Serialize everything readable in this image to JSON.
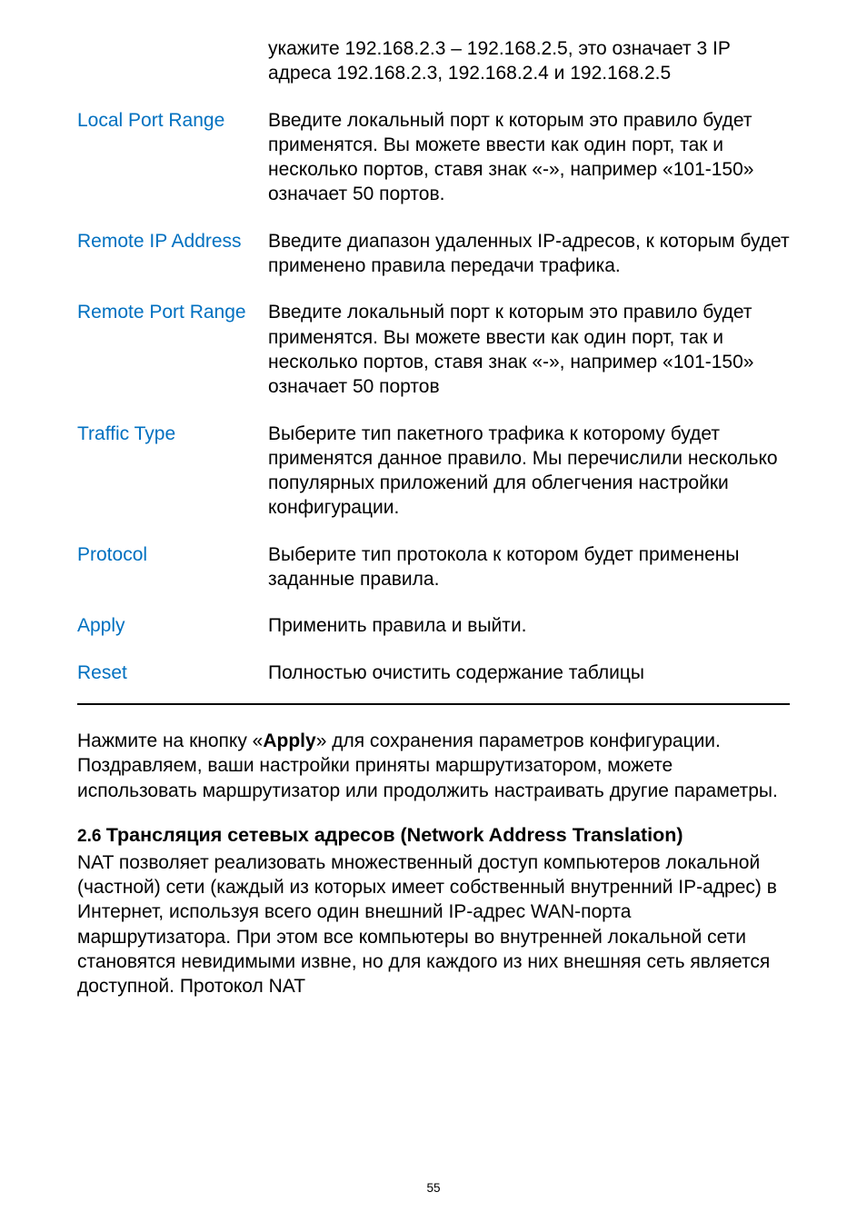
{
  "definitions": {
    "row0": {
      "term": "",
      "def": "укажите 192.168.2.3 – 192.168.2.5, это означает 3 IP адреса 192.168.2.3, 192.168.2.4 и 192.168.2.5"
    },
    "localPortRange": {
      "term": "Local Port Range",
      "def": "Введите локальный порт к которым это правило будет применятся. Вы можете ввести как один порт, так и несколько портов, ставя знак «-», например «101-150» означает 50 портов."
    },
    "remoteIpAddress": {
      "term": "Remote IP Address",
      "def": "Введите диапазон удаленных IP-адресов, к которым будет применено правила передачи трафика."
    },
    "remotePortRange": {
      "term": "Remote Port Range",
      "def": "Введите локальный порт к которым это правило будет применятся. Вы можете ввести как один порт, так и несколько портов, ставя знак «-», например «101-150» означает 50 портов"
    },
    "trafficType": {
      "term": "Traffic Type",
      "def": "Выберите тип пакетного трафика к которому будет применятся данное правило. Мы перечислили несколько популярных приложений для облегчения настройки конфигурации."
    },
    "protocol": {
      "term": "Protocol",
      "def": "Выберите тип протокола к котором будет применены заданные правила."
    },
    "apply": {
      "term": "Apply",
      "def": "Применить правила и выйти."
    },
    "reset": {
      "term": "Reset",
      "def": "Полностью очистить содержание таблицы"
    }
  },
  "paragraph": {
    "prefix": "Нажмите на кнопку «",
    "bold": "Apply",
    "suffix": "» для сохранения параметров конфигурации. Поздравляем, ваши настройки приняты маршрутизатором, можете использовать маршрутизатор или продолжить настраивать другие параметры."
  },
  "section": {
    "number": "2.6 ",
    "title": "Трансляция сетевых адресов (Network Address Translation)",
    "body": "NAT позволяет реализовать множественный доступ компьютеров локальной (частной) сети (каждый из которых имеет собственный внутренний IP-адрес) в Интернет, используя всего один внешний IP-адрес WAN-порта маршрутизатора. При этом все компьютеры во внутренней локальной сети становятся невидимыми извне, но для каждого из них внешняя сеть является доступной. Протокол NAT"
  },
  "pageNumber": "55"
}
